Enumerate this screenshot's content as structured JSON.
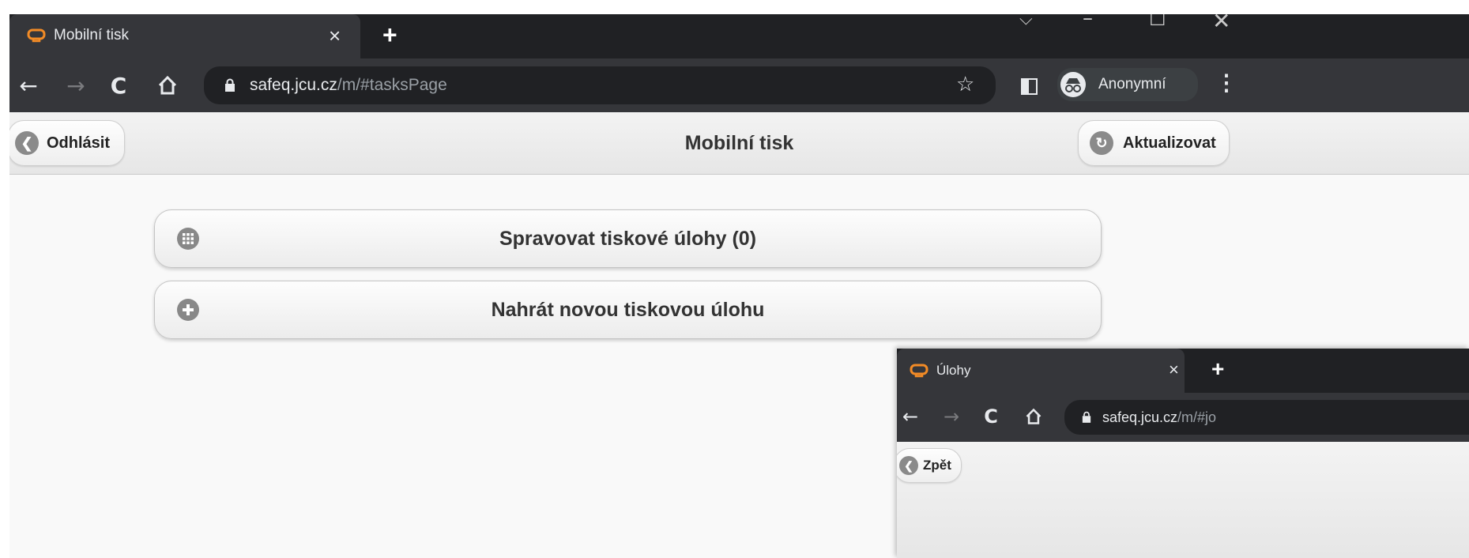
{
  "windows": [
    {
      "tab": {
        "title": "Mobilní tisk"
      },
      "omnibox": {
        "host": "safeq.jcu.cz",
        "path": "/m/#tasksPage"
      },
      "profile_label": "Anonymní",
      "page": {
        "title": "Mobilní tisk",
        "left_button": "Odhlásit",
        "right_button": "Aktualizovat",
        "actions": [
          {
            "label": "Spravovat tiskové úlohy (0)",
            "icon": "grid-icon"
          },
          {
            "label": "Nahrát novou tiskovou úlohu",
            "icon": "plus-icon"
          }
        ]
      }
    },
    {
      "tab": {
        "title": "Úlohy"
      },
      "omnibox": {
        "host": "safeq.jcu.cz",
        "path": "/m/#jo"
      },
      "page": {
        "left_button": "Zpět"
      }
    }
  ],
  "colors": {
    "tabstrip": "#202124",
    "toolbar": "#35363a",
    "favicon": "#f28b26",
    "header_bg": "#ececec"
  }
}
